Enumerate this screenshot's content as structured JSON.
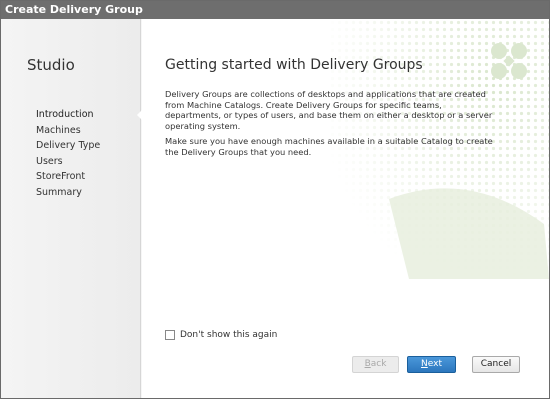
{
  "window": {
    "title": "Create Delivery Group"
  },
  "sidebar": {
    "title": "Studio",
    "steps": [
      {
        "label": "Introduction",
        "active": true
      },
      {
        "label": "Machines"
      },
      {
        "label": "Delivery Type"
      },
      {
        "label": "Users"
      },
      {
        "label": "StoreFront"
      },
      {
        "label": "Summary"
      }
    ]
  },
  "main": {
    "heading": "Getting started with Delivery Groups",
    "paragraph1": "Delivery Groups are collections of desktops and applications that are created from Machine Catalogs. Create Delivery Groups for specific teams, departments, or types of users, and base them on either a desktop or a server operating system.",
    "paragraph2": "Make sure you have enough machines available in a suitable Catalog to create the Delivery Groups that you need.",
    "dont_show_label": "Don't show this again",
    "dont_show_checked": false
  },
  "buttons": {
    "back_first": "B",
    "back_rest": "ack",
    "next_first": "N",
    "next_rest": "ext",
    "cancel": "Cancel"
  },
  "colors": {
    "accent": "#2c77bd",
    "decor": "#c7d8b4",
    "titlebar": "#6e6e6e"
  }
}
